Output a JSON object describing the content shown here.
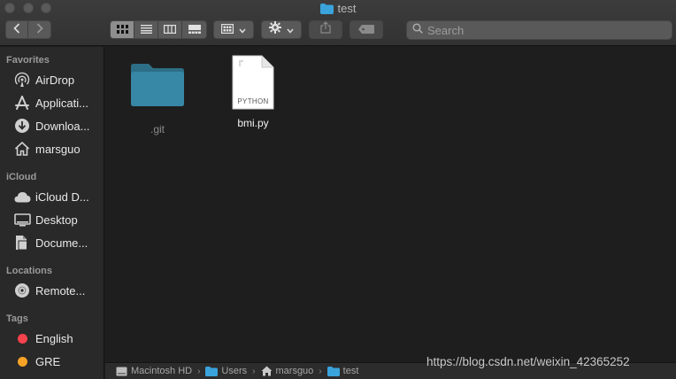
{
  "window": {
    "title": "test"
  },
  "toolbar": {
    "back_icon": "chevron-left-icon",
    "forward_icon": "chevron-right-icon",
    "view_modes": [
      "icon-view",
      "list-view",
      "column-view",
      "gallery-view"
    ],
    "active_view": "icon-view",
    "search_placeholder": "Search"
  },
  "sidebar": {
    "sections": [
      {
        "title": "Favorites",
        "items": [
          {
            "label": "AirDrop",
            "icon": "airdrop-icon"
          },
          {
            "label": "Applicati...",
            "icon": "applications-icon"
          },
          {
            "label": "Downloa...",
            "icon": "downloads-icon"
          },
          {
            "label": "marsguo",
            "icon": "home-icon"
          }
        ]
      },
      {
        "title": "iCloud",
        "items": [
          {
            "label": "iCloud D...",
            "icon": "cloud-icon"
          },
          {
            "label": "Desktop",
            "icon": "desktop-icon"
          },
          {
            "label": "Docume...",
            "icon": "documents-icon"
          }
        ]
      },
      {
        "title": "Locations",
        "items": [
          {
            "label": "Remote...",
            "icon": "disc-icon"
          }
        ]
      },
      {
        "title": "Tags",
        "items": [
          {
            "label": "English",
            "icon": "tag-dot-icon",
            "color": "#f5424d"
          },
          {
            "label": "GRE",
            "icon": "tag-dot-icon",
            "color": "#f7a426"
          }
        ]
      }
    ]
  },
  "files": [
    {
      "name": ".git",
      "kind": "folder",
      "dimmed": true
    },
    {
      "name": "bmi.py",
      "kind": "document",
      "badge": "PYTHON"
    }
  ],
  "pathbar": {
    "items": [
      {
        "label": "Macintosh HD",
        "icon": "drive-icon"
      },
      {
        "label": "Users",
        "icon": "folder-icon"
      },
      {
        "label": "marsguo",
        "icon": "home-icon"
      },
      {
        "label": "test",
        "icon": "folder-icon"
      }
    ]
  },
  "watermark": "https://blog.csdn.net/weixin_42365252",
  "colors": {
    "folder": "#3b8fb0",
    "accent_active": "#8e8e8e",
    "tag_english": "#f5424d",
    "tag_gre": "#f7a426"
  }
}
